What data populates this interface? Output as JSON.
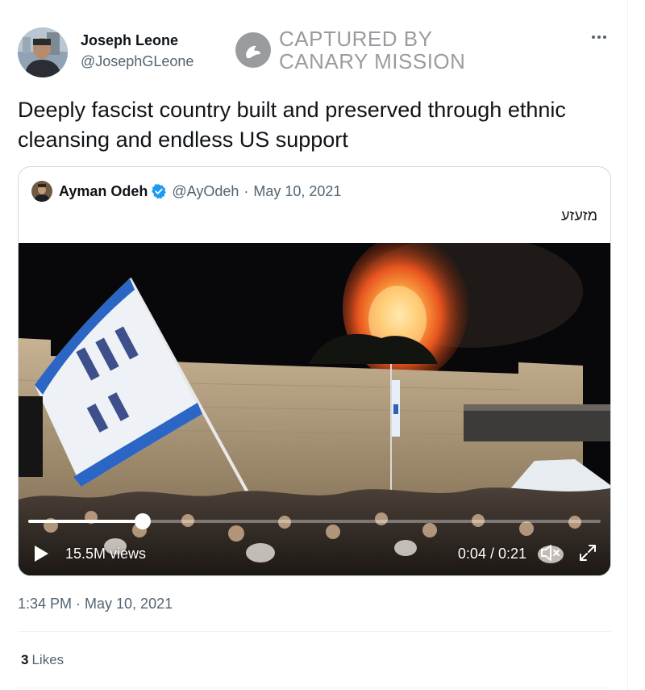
{
  "author": {
    "name": "Joseph Leone",
    "handle": "@JosephGLeone"
  },
  "watermark": {
    "line1": "CAPTURED BY",
    "line2": "CANARY MISSION"
  },
  "tweet": {
    "text": "Deeply fascist country built and preserved through ethnic cleansing and endless US support",
    "timestamp": "1:34 PM · May 10, 2021"
  },
  "quoted": {
    "name": "Ayman Odeh",
    "handle": "@AyOdeh",
    "separator": "·",
    "date": "May 10, 2021",
    "text": "מזעזע",
    "verified": true
  },
  "video": {
    "views": "15.5M views",
    "time": "0:04 / 0:21",
    "progress": 0.2,
    "muted": true
  },
  "engagement": {
    "likes_count": "3",
    "likes_label": "Likes"
  },
  "icons": {
    "more": "more-horizontal-icon",
    "verified": "verified-badge-icon",
    "play": "play-icon",
    "mute": "volume-muted-icon",
    "fullscreen": "fullscreen-icon",
    "watermark": "canary-bird-icon"
  },
  "colors": {
    "text": "#0f1419",
    "secondary": "#536471",
    "verified": "#1d9bf0",
    "border": "#cfd9de"
  }
}
